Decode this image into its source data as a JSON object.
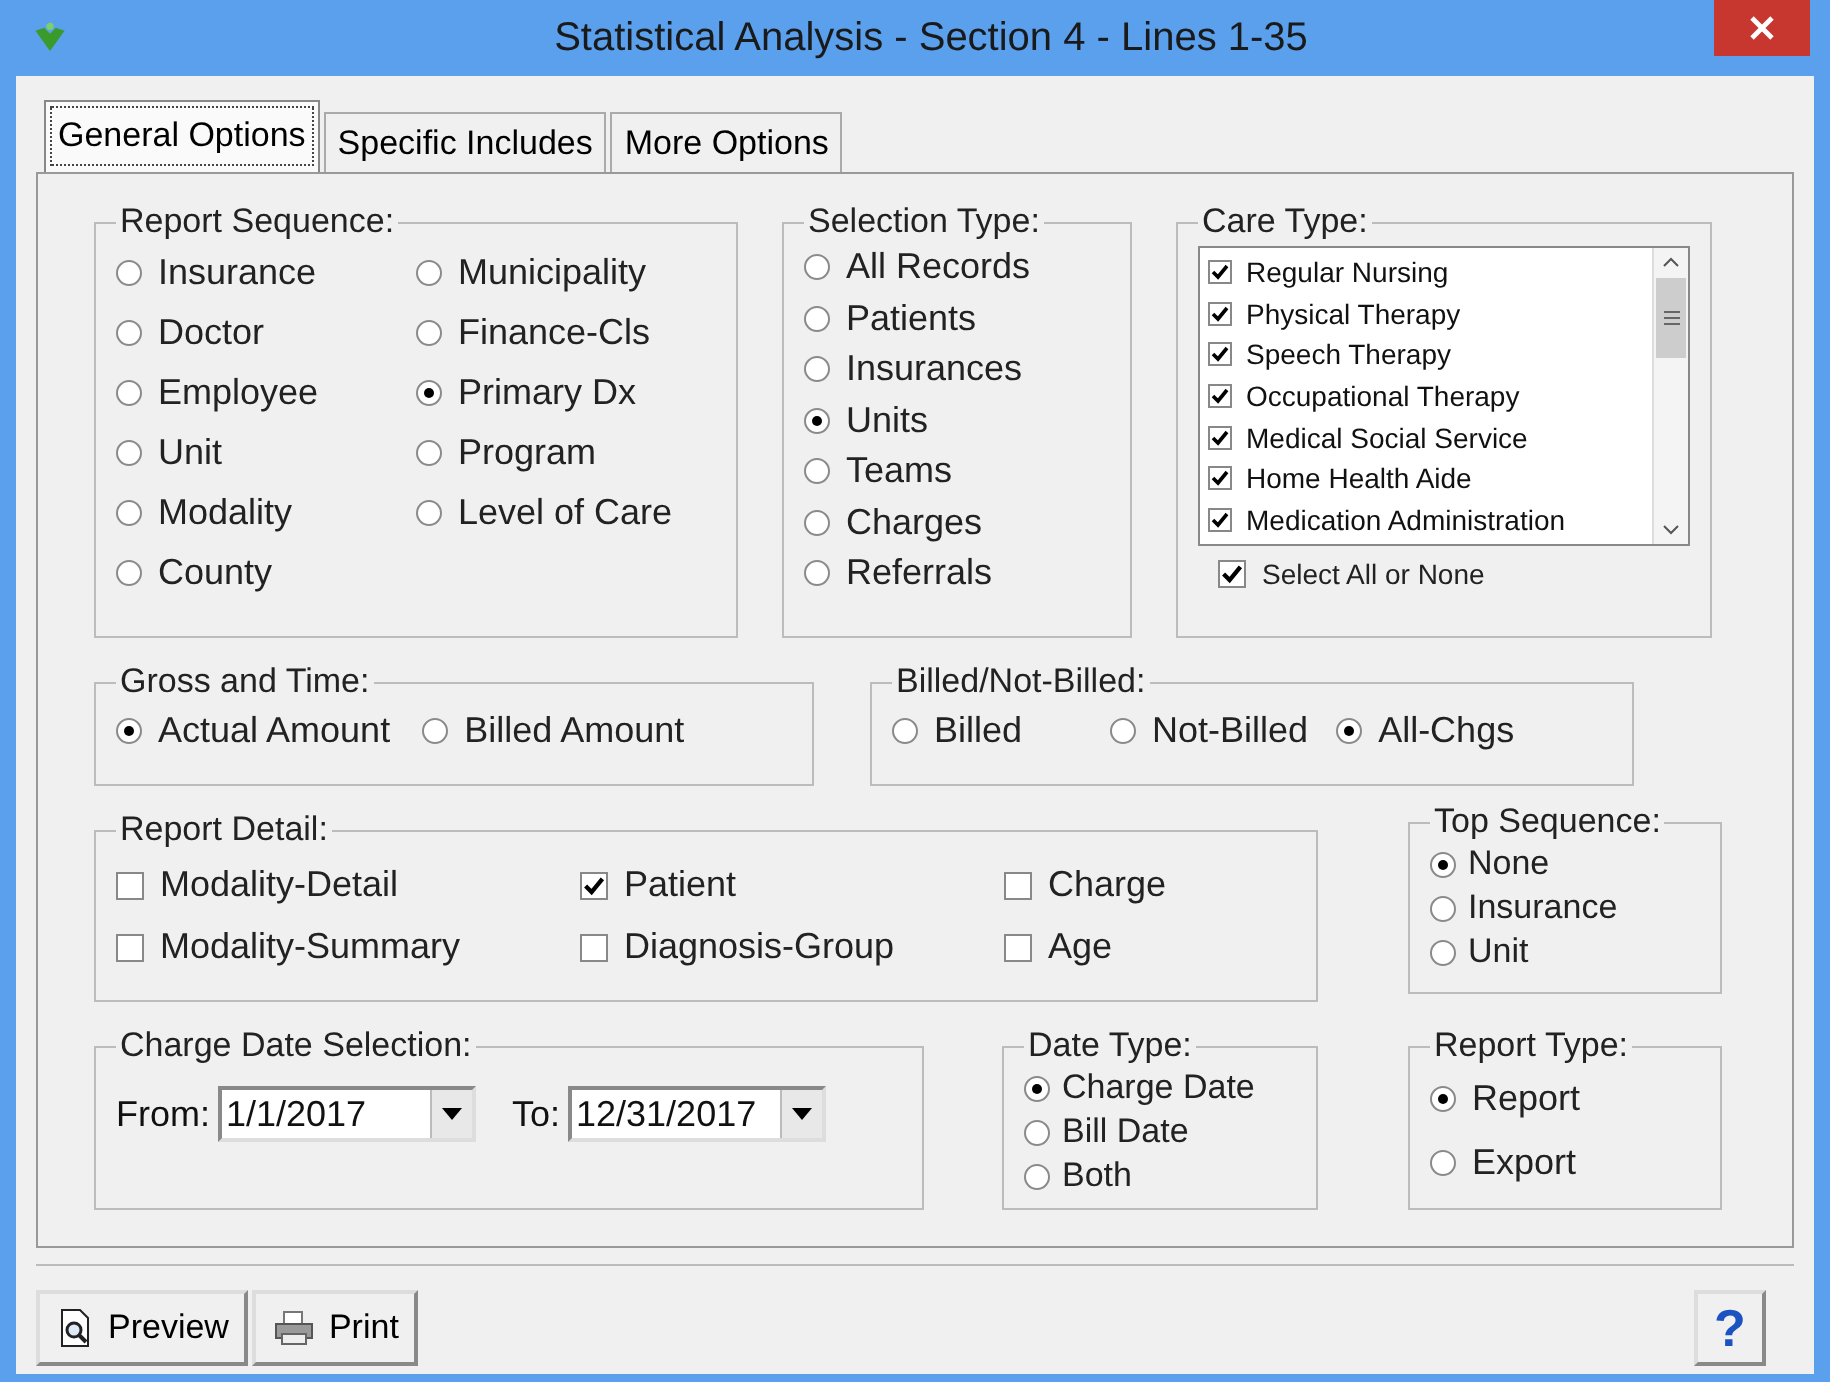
{
  "window": {
    "title": "Statistical Analysis - Section 4 - Lines 1-35"
  },
  "tabs": [
    {
      "label": "General Options",
      "selected": true
    },
    {
      "label": "Specific Includes",
      "selected": false
    },
    {
      "label": "More Options",
      "selected": false
    }
  ],
  "report_sequence": {
    "label": "Report Sequence:",
    "options": [
      {
        "label": "Insurance",
        "selected": false
      },
      {
        "label": "Doctor",
        "selected": false
      },
      {
        "label": "Employee",
        "selected": false
      },
      {
        "label": "Unit",
        "selected": false
      },
      {
        "label": "Modality",
        "selected": false
      },
      {
        "label": "County",
        "selected": false
      },
      {
        "label": "Municipality",
        "selected": false
      },
      {
        "label": "Finance-Cls",
        "selected": false
      },
      {
        "label": "Primary Dx",
        "selected": true
      },
      {
        "label": "Program",
        "selected": false
      },
      {
        "label": "Level of Care",
        "selected": false
      }
    ]
  },
  "selection_type": {
    "label": "Selection Type:",
    "options": [
      {
        "label": "All Records",
        "selected": false
      },
      {
        "label": "Patients",
        "selected": false
      },
      {
        "label": "Insurances",
        "selected": false
      },
      {
        "label": "Units",
        "selected": true
      },
      {
        "label": "Teams",
        "selected": false
      },
      {
        "label": "Charges",
        "selected": false
      },
      {
        "label": "Referrals",
        "selected": false
      }
    ]
  },
  "care_type": {
    "label": "Care Type:",
    "items": [
      {
        "label": "Regular Nursing",
        "checked": true
      },
      {
        "label": "Physical Therapy",
        "checked": true
      },
      {
        "label": "Speech Therapy",
        "checked": true
      },
      {
        "label": "Occupational Therapy",
        "checked": true
      },
      {
        "label": "Medical Social Service",
        "checked": true
      },
      {
        "label": "Home Health Aide",
        "checked": true
      },
      {
        "label": "Medication Administration",
        "checked": true
      }
    ],
    "select_all": {
      "label": "Select All or None",
      "checked": true
    }
  },
  "gross_and_time": {
    "label": "Gross and Time:",
    "options": [
      {
        "label": "Actual Amount",
        "selected": true
      },
      {
        "label": "Billed Amount",
        "selected": false
      }
    ]
  },
  "billed": {
    "label": "Billed/Not-Billed:",
    "options": [
      {
        "label": "Billed",
        "selected": false
      },
      {
        "label": "Not-Billed",
        "selected": false
      },
      {
        "label": "All-Chgs",
        "selected": true
      }
    ]
  },
  "report_detail": {
    "label": "Report Detail:",
    "items": [
      {
        "label": "Modality-Detail",
        "checked": false
      },
      {
        "label": "Modality-Summary",
        "checked": false
      },
      {
        "label": "Patient",
        "checked": true
      },
      {
        "label": "Diagnosis-Group",
        "checked": false
      },
      {
        "label": "Charge",
        "checked": false
      },
      {
        "label": "Age",
        "checked": false
      }
    ]
  },
  "top_sequence": {
    "label": "Top Sequence:",
    "options": [
      {
        "label": "None",
        "selected": true
      },
      {
        "label": "Insurance",
        "selected": false
      },
      {
        "label": "Unit",
        "selected": false
      }
    ]
  },
  "charge_date": {
    "label": "Charge Date Selection:",
    "from_label": "From:",
    "from_value": "1/1/2017",
    "to_label": "To:",
    "to_value": "12/31/2017"
  },
  "date_type": {
    "label": "Date Type:",
    "options": [
      {
        "label": "Charge Date",
        "selected": true
      },
      {
        "label": "Bill Date",
        "selected": false
      },
      {
        "label": "Both",
        "selected": false
      }
    ]
  },
  "report_type": {
    "label": "Report Type:",
    "options": [
      {
        "label": "Report",
        "selected": true
      },
      {
        "label": "Export",
        "selected": false
      }
    ]
  },
  "buttons": [
    {
      "kind": "preview",
      "label": "Preview"
    },
    {
      "kind": "print",
      "label": "Print"
    },
    {
      "kind": "help",
      "label": "?"
    }
  ]
}
